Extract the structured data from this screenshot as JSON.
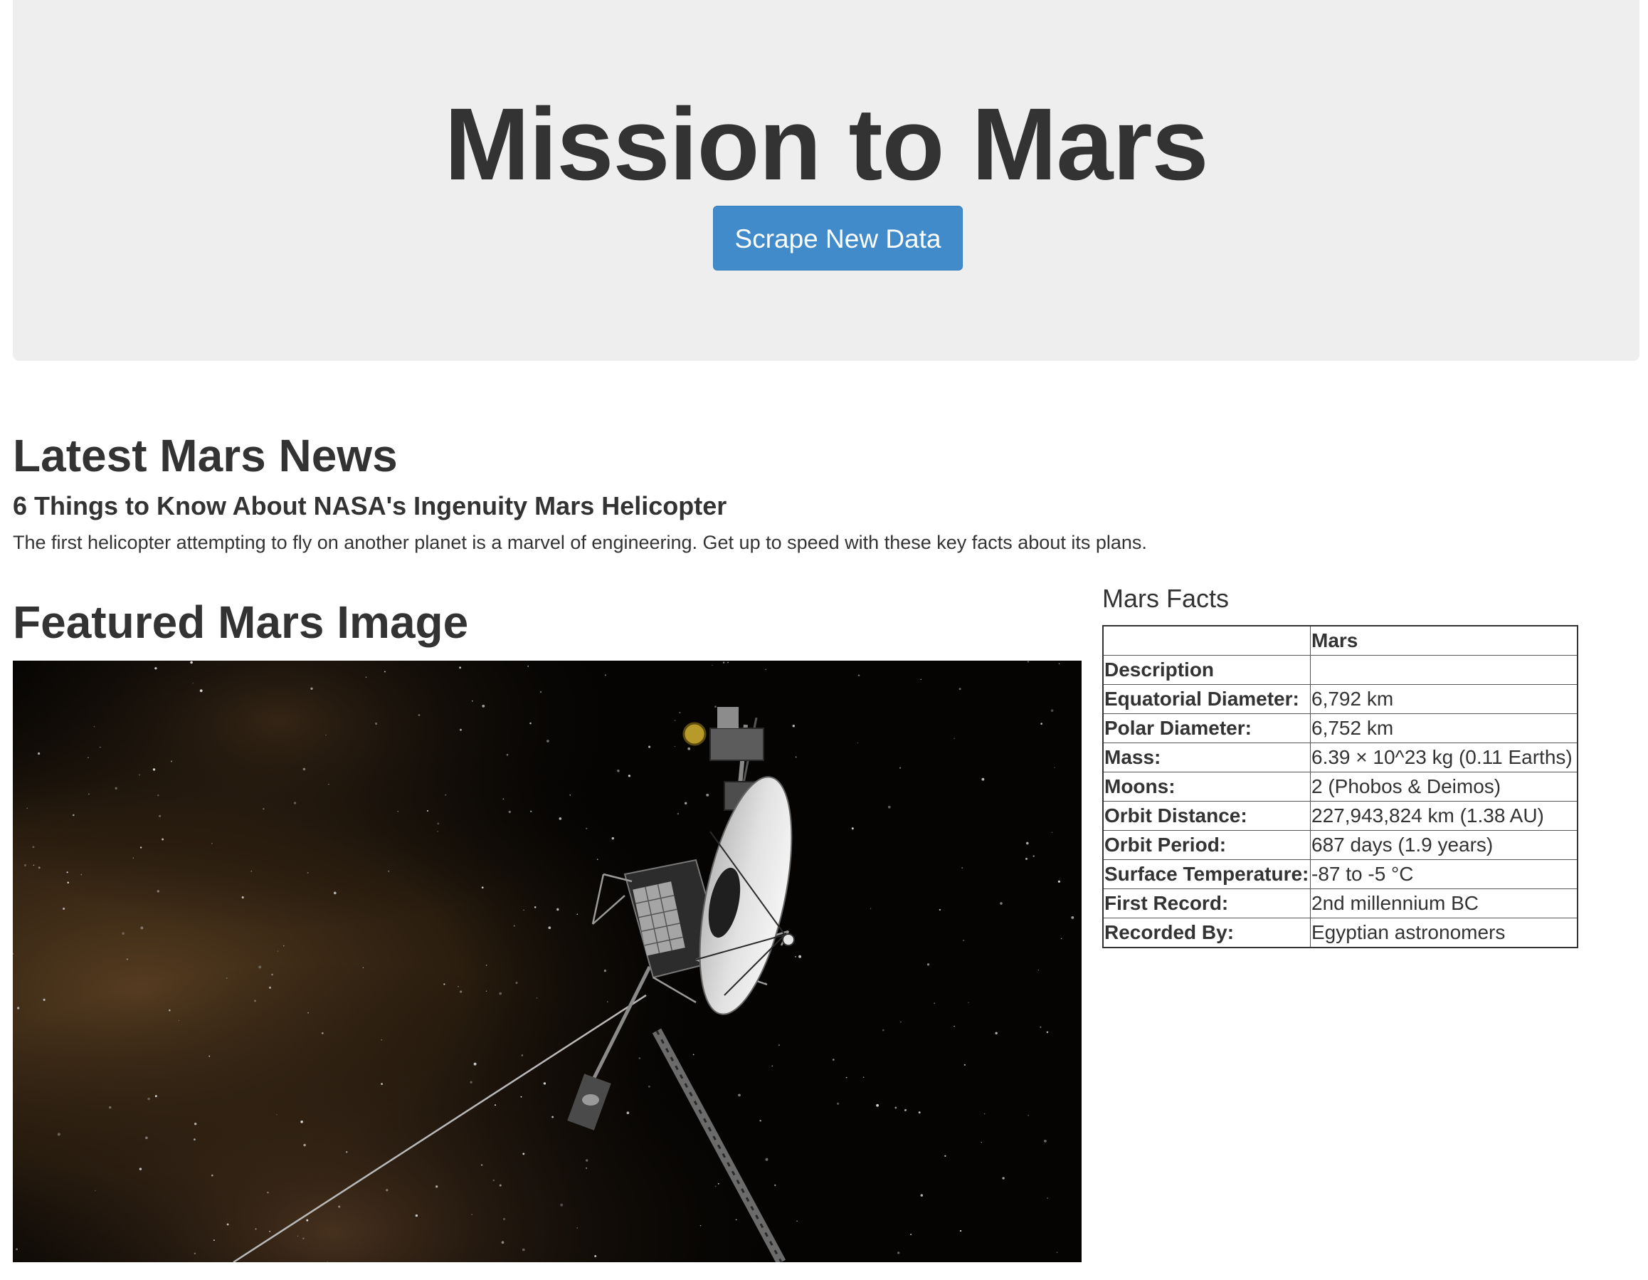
{
  "header": {
    "title": "Mission to Mars",
    "scrape_button_label": "Scrape New Data"
  },
  "news": {
    "heading": "Latest Mars News",
    "title": "6 Things to Know About NASA's Ingenuity Mars Helicopter",
    "teaser": "The first helicopter attempting to fly on another planet is a marvel of engineering. Get up to speed with these key facts about its plans."
  },
  "featured_image": {
    "heading": "Featured Mars Image"
  },
  "facts": {
    "heading": "Mars Facts",
    "columns": [
      "",
      "Mars"
    ],
    "rows": [
      {
        "label": "Description",
        "value": ""
      },
      {
        "label": "Equatorial Diameter:",
        "value": "6,792 km"
      },
      {
        "label": "Polar Diameter:",
        "value": "6,752 km"
      },
      {
        "label": "Mass:",
        "value": "6.39 × 10^23 kg (0.11 Earths)"
      },
      {
        "label": "Moons:",
        "value": "2 (Phobos & Deimos)"
      },
      {
        "label": "Orbit Distance:",
        "value": "227,943,824 km (1.38 AU)"
      },
      {
        "label": "Orbit Period:",
        "value": "687 days (1.9 years)"
      },
      {
        "label": "Surface Temperature:",
        "value": "-87 to -5 °C"
      },
      {
        "label": "First Record:",
        "value": "2nd millennium BC"
      },
      {
        "label": "Recorded By:",
        "value": "Egyptian astronomers"
      }
    ]
  },
  "colors": {
    "jumbotron_bg": "#eeeeee",
    "button_bg": "#428bca",
    "text": "#333333"
  }
}
